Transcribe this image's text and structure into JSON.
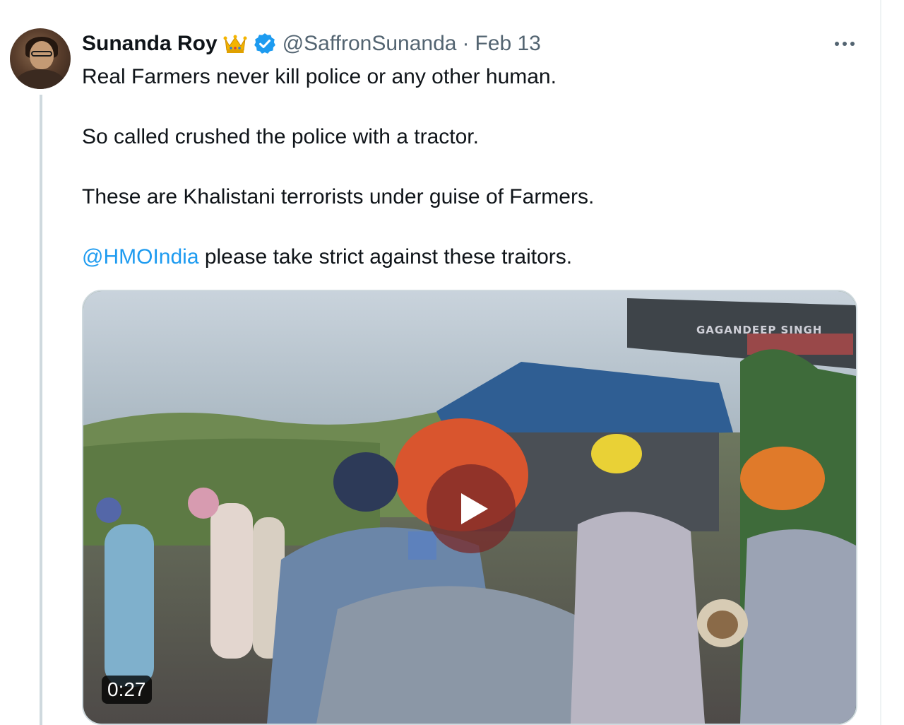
{
  "tweet": {
    "author": {
      "display_name": "Sunanda Roy",
      "handle": "@SaffronSunanda",
      "separator": "·",
      "date": "Feb 13",
      "badge_icon": "crown-icon",
      "verified_icon": "verified-badge-icon"
    },
    "text": {
      "line1": "Real Farmers never kill police or any other human.",
      "line2": "So called crushed the police with a tractor.",
      "line3": "These are Khalistani terrorists under guise of Farmers.",
      "mention": "@HMOIndia",
      "line4_rest": " please take strict against these traitors."
    },
    "media": {
      "type": "video",
      "duration": "0:27",
      "watermark": "GAGANDEEP SINGH"
    },
    "more_icon": "more-options-icon"
  },
  "colors": {
    "link": "#1d9bf0",
    "verified": "#1d9bf0",
    "secondary_text": "#536471",
    "thread_line": "#cfd9de"
  }
}
